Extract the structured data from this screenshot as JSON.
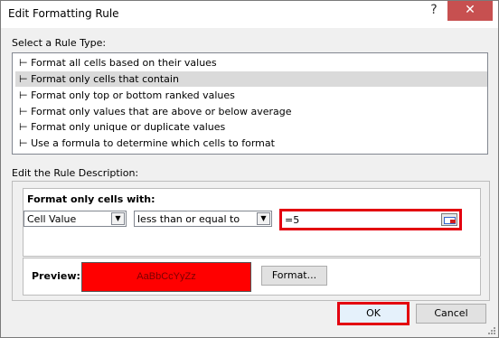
{
  "window": {
    "title": "Edit Formatting Rule",
    "help_label": "?",
    "close_label": "✕"
  },
  "rule_type": {
    "label": "Select a Rule Type:",
    "bullet": "⊢",
    "items": [
      "Format all cells based on their values",
      "Format only cells that contain",
      "Format only top or bottom ranked values",
      "Format only values that are above or below average",
      "Format only unique or duplicate values",
      "Use a formula to determine which cells to format"
    ],
    "selected_index": 1
  },
  "description": {
    "label": "Edit the Rule Description:",
    "format_label": "Format only cells with:",
    "condition_type": "Cell Value",
    "operator": "less than or equal to",
    "value": "=5",
    "preview_label": "Preview:",
    "preview_text": "AaBbCcYyZz",
    "preview_fill": "#ff0000",
    "format_button": "Format..."
  },
  "buttons": {
    "ok": "OK",
    "cancel": "Cancel"
  },
  "colors": {
    "highlight_box": "#e3000f",
    "close_button": "#c75050"
  }
}
